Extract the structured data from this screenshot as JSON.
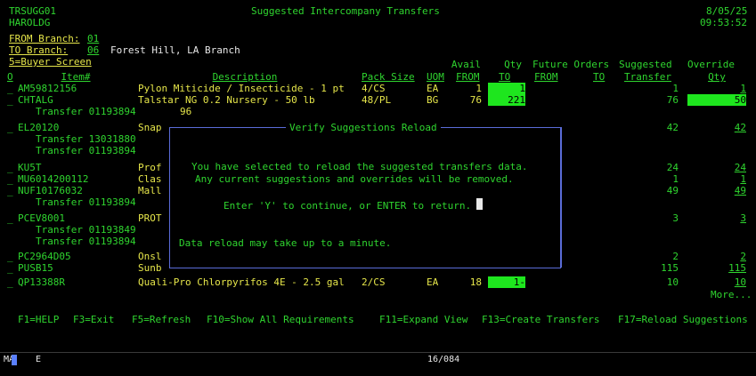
{
  "header": {
    "program": "TRSUGG01",
    "user": "HAROLDG",
    "title": "Suggested Intercompany Transfers",
    "date": "8/05/25",
    "time": "09:53:52",
    "from_label": "FROM Branch:",
    "from_value": "01",
    "to_label": "TO Branch:",
    "to_value": "06",
    "to_name": "Forest Hill, LA Branch",
    "buyer_label": "5=Buyer Screen"
  },
  "columns": {
    "opt": "O",
    "item": "Item#",
    "description": "Description",
    "pack": "Pack Size",
    "uom": "UOM",
    "avail_top": "Avail",
    "avail_bottom": "FROM",
    "qty_top": "Qty",
    "qty_bottom": "TO",
    "future_top": "Future Orders",
    "future_from": "FROM",
    "future_to": "TO",
    "suggested_top": "Suggested",
    "suggested_bottom": "Transfer",
    "override_top": "Override",
    "override_bottom": "Qty"
  },
  "rows": [
    {
      "opt": "_",
      "item": "AM59812156",
      "desc": "Pylon Miticide / Insecticide - 1 pt",
      "pack": "4/CS",
      "uom": "EA",
      "avail": "1",
      "qty_to": "1",
      "suggested": "1",
      "override": "1"
    },
    {
      "opt": "_",
      "item": "CHTALG",
      "desc": "Talstar NG 0.2 Nursery - 50 lb",
      "pack": "48/PL",
      "uom": "BG",
      "avail": "76",
      "qty_to": "221",
      "suggested": "76",
      "override": "50"
    },
    {
      "opt": "",
      "item": "Transfer 01193894",
      "desc": "96",
      "pack": "",
      "uom": "",
      "avail": "",
      "qty_to": "",
      "suggested": "",
      "override": ""
    },
    {
      "opt": "_",
      "item": "EL20120",
      "desc": "Snap",
      "pack": "",
      "uom": "",
      "avail": "",
      "qty_to": "",
      "suggested": "42",
      "override": "42"
    },
    {
      "opt": "",
      "item": "Transfer 13031880",
      "desc": "",
      "pack": "",
      "uom": "",
      "avail": "",
      "qty_to": "",
      "suggested": "",
      "override": ""
    },
    {
      "opt": "",
      "item": "Transfer 01193894",
      "desc": "",
      "pack": "",
      "uom": "",
      "avail": "",
      "qty_to": "",
      "suggested": "",
      "override": ""
    },
    {
      "opt": "_",
      "item": "KU5T",
      "desc": "Prof",
      "pack": "",
      "uom": "",
      "avail": "",
      "qty_to": "",
      "suggested": "24",
      "override": "24"
    },
    {
      "opt": "_",
      "item": "MU6014200112",
      "desc": "Clas",
      "pack": "",
      "uom": "",
      "avail": "",
      "qty_to": "",
      "suggested": "1",
      "override": "1"
    },
    {
      "opt": "_",
      "item": "NUF10176032",
      "desc": "Mall",
      "pack": "",
      "uom": "",
      "avail": "",
      "qty_to": "",
      "suggested": "49",
      "override": "49"
    },
    {
      "opt": "",
      "item": "Transfer 01193894",
      "desc": "",
      "pack": "",
      "uom": "",
      "avail": "",
      "qty_to": "",
      "suggested": "",
      "override": ""
    },
    {
      "opt": "_",
      "item": "PCEV8001",
      "desc": "PROT",
      "pack": "",
      "uom": "",
      "avail": "",
      "qty_to": "",
      "suggested": "3",
      "override": "3"
    },
    {
      "opt": "",
      "item": "Transfer 01193849",
      "desc": "",
      "pack": "",
      "uom": "",
      "avail": "",
      "qty_to": "",
      "suggested": "",
      "override": ""
    },
    {
      "opt": "",
      "item": "Transfer 01193894",
      "desc": "",
      "pack": "",
      "uom": "",
      "avail": "",
      "qty_to": "",
      "suggested": "",
      "override": ""
    },
    {
      "opt": "_",
      "item": "PC2964D05",
      "desc": "Onsl",
      "pack": "",
      "uom": "",
      "avail": "",
      "qty_to": "",
      "suggested": "2",
      "override": "2"
    },
    {
      "opt": "_",
      "item": "PUSB15",
      "desc": "Sunb",
      "pack": "",
      "uom": "",
      "avail": "",
      "qty_to": "",
      "suggested": "115",
      "override": "115"
    },
    {
      "opt": "_",
      "item": "QP13388R",
      "desc": "Quali-Pro Chlorpyrifos 4E - 2.5 gal",
      "pack": "2/CS",
      "uom": "EA",
      "avail": "18",
      "qty_to": "1-",
      "suggested": "10",
      "override": "10"
    }
  ],
  "more": "More...",
  "function_keys": [
    "F1=HELP",
    "F3=Exit",
    "F5=Refresh",
    "F10=Show All Requirements",
    "F11=Expand View",
    "F13=Create Transfers",
    "F17=Reload Suggestions"
  ],
  "dialog": {
    "title": "Verify Suggestions Reload",
    "line1": "You have selected to reload the suggested transfers data.",
    "line2": "Any current suggestions and overrides will be removed.",
    "prompt": "Enter 'Y' to continue, or ENTER to return.",
    "note": "Data reload may take up to a minute."
  },
  "status_bar": {
    "mode": "MA",
    "indicator": "E",
    "position": "16/084"
  },
  "colors": {
    "text_green": "#2fd52f",
    "yellow": "#e6e64a",
    "highlight": "#1ee61e",
    "dialog_border": "#5a6cd8"
  }
}
